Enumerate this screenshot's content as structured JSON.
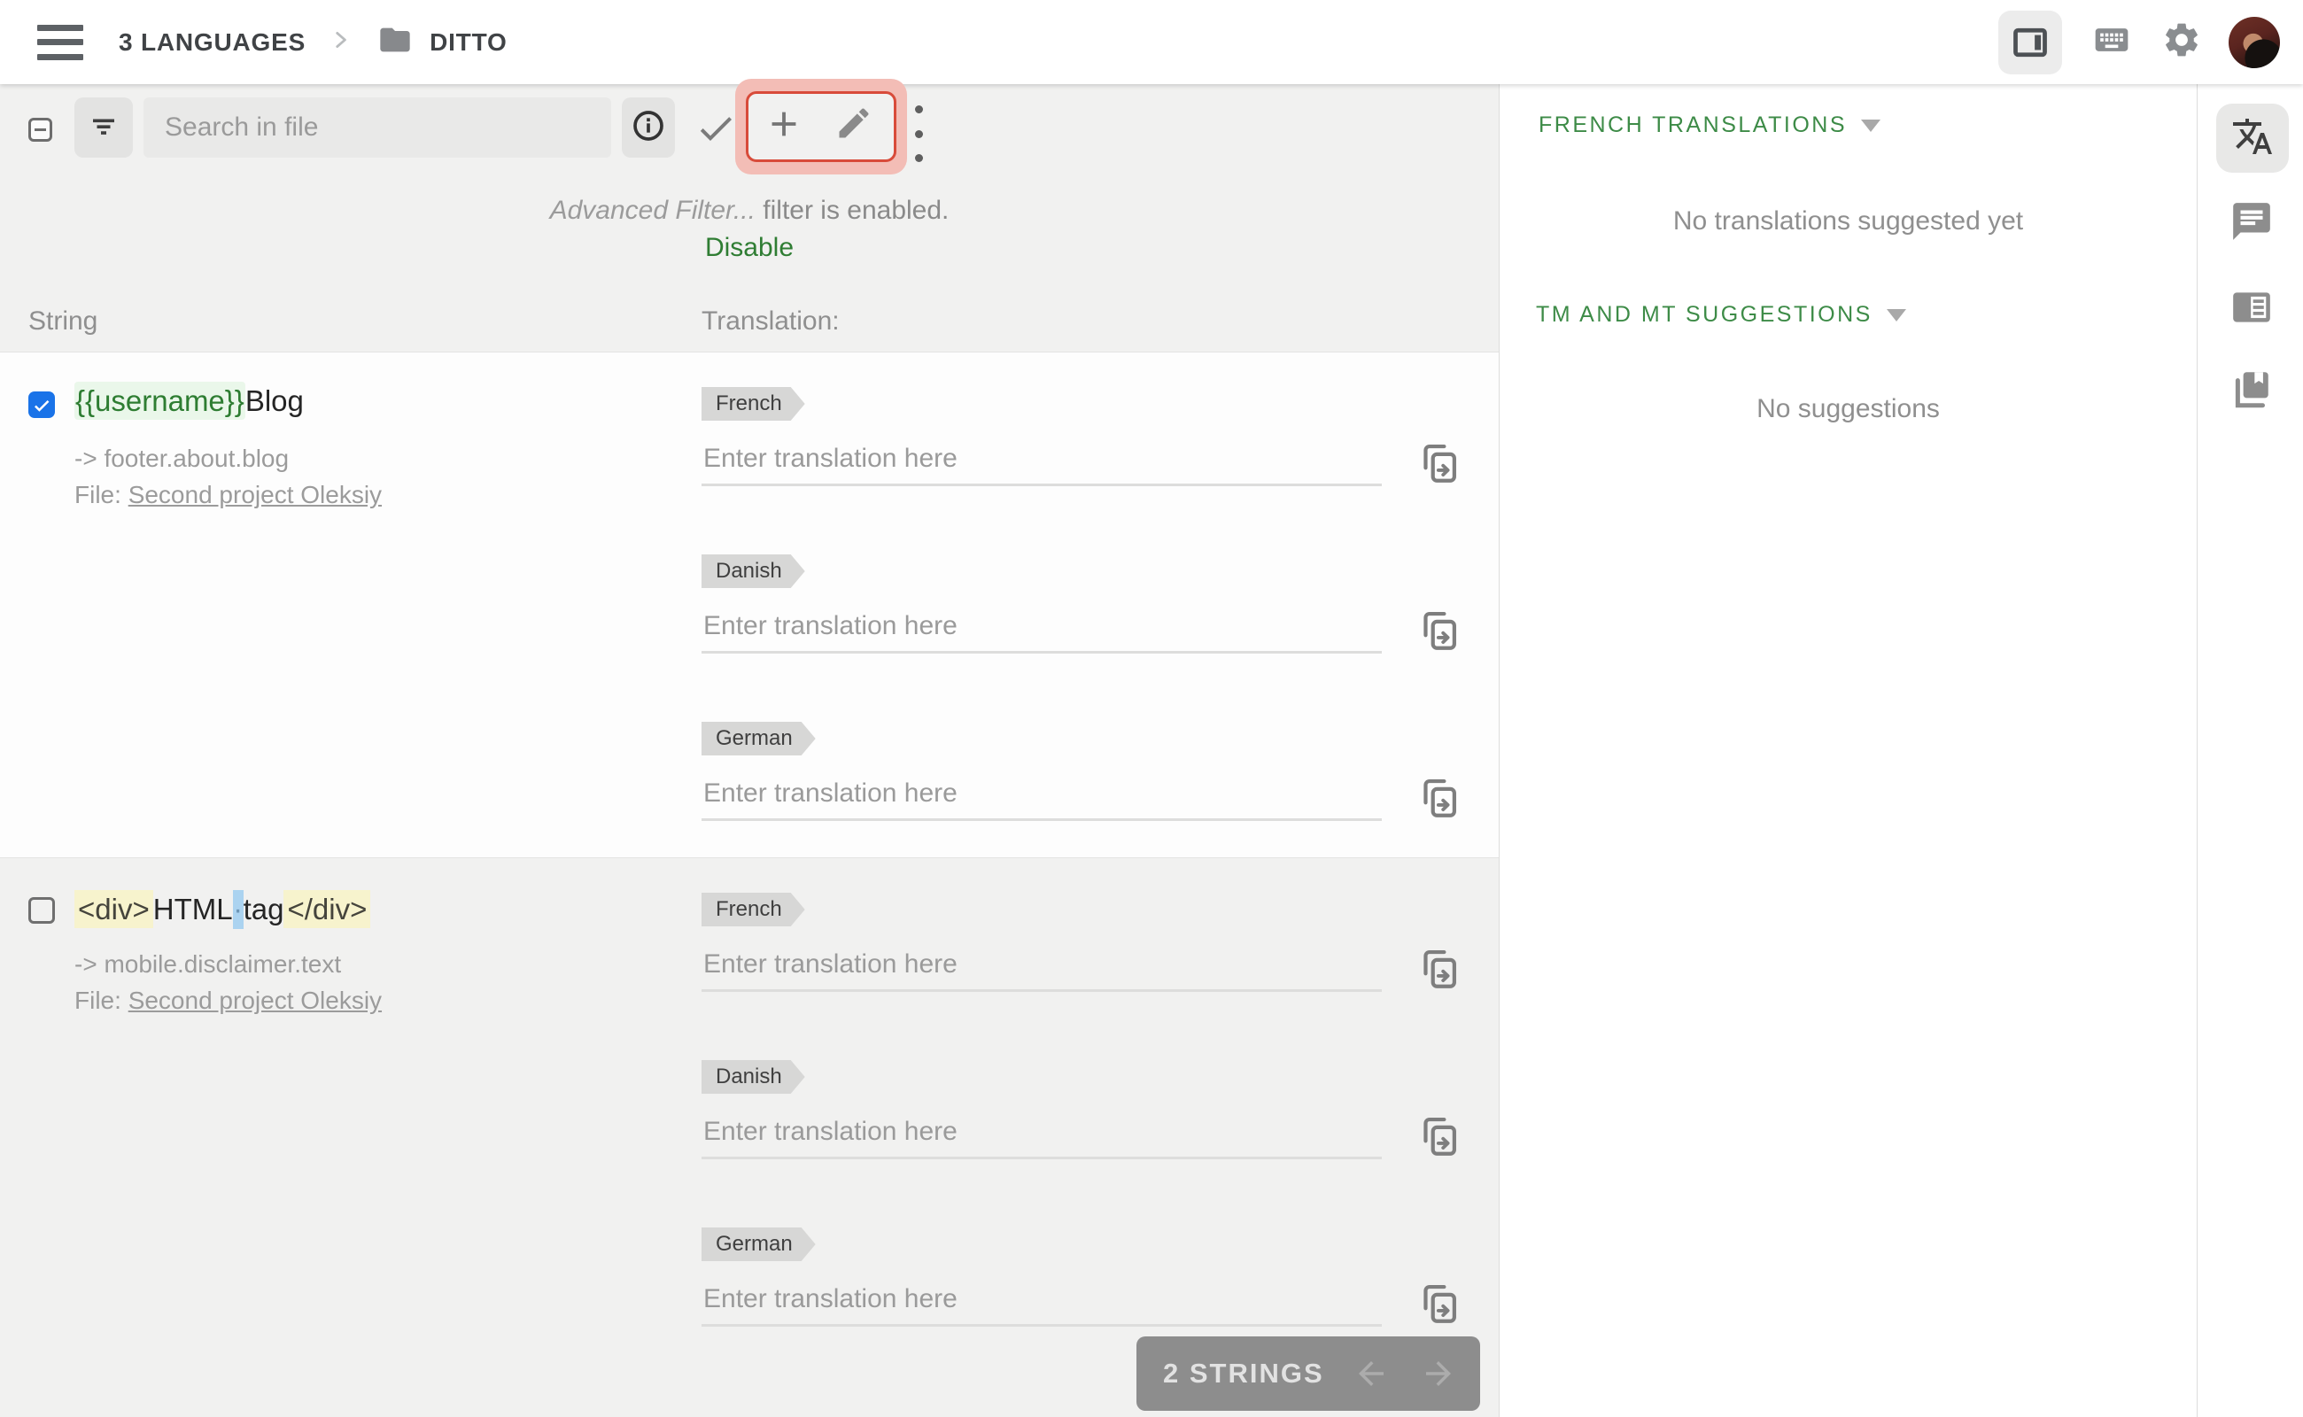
{
  "header": {
    "breadcrumb_root": "3 LANGUAGES",
    "breadcrumb_current": "DITTO"
  },
  "toolbar": {
    "search_placeholder": "Search in file",
    "filter_notice_em": "Advanced Filter...",
    "filter_notice_rest": " filter is enabled.",
    "disable_link": "Disable"
  },
  "table": {
    "col_string": "String",
    "col_translation": "Translation:"
  },
  "rows": [
    {
      "checked": true,
      "string_parts": [
        {
          "t": "{{username}}",
          "s": "var"
        },
        {
          "t": "Blog",
          "s": "plain"
        }
      ],
      "key_path": "-> footer.about.blog",
      "file_label": "File:",
      "file_link": "Second project Oleksiy",
      "translations": [
        {
          "language": "French",
          "placeholder": "Enter translation here",
          "value": ""
        },
        {
          "language": "Danish",
          "placeholder": "Enter translation here",
          "value": ""
        },
        {
          "language": "German",
          "placeholder": "Enter translation here",
          "value": ""
        }
      ]
    },
    {
      "checked": false,
      "string_parts": [
        {
          "t": "<div>",
          "s": "tag"
        },
        {
          "t": "HTML",
          "s": "plain"
        },
        {
          "t": "·",
          "s": "space"
        },
        {
          "t": "tag",
          "s": "plain"
        },
        {
          "t": "</div>",
          "s": "tag"
        }
      ],
      "key_path": "-> mobile.disclaimer.text",
      "file_label": "File:",
      "file_link": "Second project Oleksiy",
      "translations": [
        {
          "language": "French",
          "placeholder": "Enter translation here",
          "value": ""
        },
        {
          "language": "Danish",
          "placeholder": "Enter translation here",
          "value": ""
        },
        {
          "language": "German",
          "placeholder": "Enter translation here",
          "value": ""
        }
      ]
    }
  ],
  "pager": {
    "count": "2 STRINGS"
  },
  "right_panel": {
    "sections": [
      {
        "title": "FRENCH TRANSLATIONS",
        "empty": "No translations suggested yet"
      },
      {
        "title": "TM AND MT SUGGESTIONS",
        "empty": "No suggestions"
      }
    ]
  },
  "colors": {
    "accent_green": "#3d8b47",
    "disable_green": "#2f7d33",
    "checkbox_blue": "#1a73e8",
    "annotation_fill": "#f3bdb6",
    "annotation_border": "#d84b3a",
    "variable_highlight": "#eaf7ea",
    "tag_highlight": "#f7f3cd",
    "space_highlight": "#abd3f0",
    "pager_bg": "#8d8d8d"
  }
}
